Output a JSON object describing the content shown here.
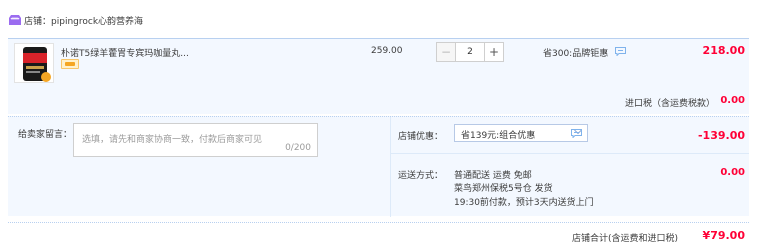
{
  "store": {
    "label": "店铺：",
    "name": "pipingrock心韵营养海"
  },
  "item": {
    "title": "朴诺T5绿羊藿胃专宾玛咖量丸...",
    "unit_price": "259.00",
    "quantity": "2",
    "minus": "−",
    "plus": "+",
    "promotion": "省300:品牌钜惠",
    "total": "218.00"
  },
  "tax": {
    "label": "进口税（含运费税款）",
    "value": "0.00"
  },
  "message": {
    "label": "给卖家留言：",
    "placeholder": "选填，请先和商家协商一致，付款后商家可见",
    "counter": "0/200"
  },
  "coupon": {
    "label": "店铺优惠：",
    "selected": "省139元:组合优惠",
    "amount": "-139.00"
  },
  "shipping": {
    "label": "运送方式：",
    "line1": "普通配送 运费 免邮",
    "line2": "菜鸟郑州保税5号仓  发货",
    "line3": "19:30前付款，预计3天内送货上门",
    "amount": "0.00"
  },
  "footer": {
    "label": "店铺合计(含运费和进口税)",
    "total": "¥79.00"
  },
  "colors": {
    "price_red": "#ff0036",
    "panel_bg": "#f3f8ff",
    "store_icon": "#9b6cf0"
  },
  "icons": [
    "store-icon",
    "product-thumbnail",
    "chat-icon",
    "chevron-down-icon"
  ]
}
